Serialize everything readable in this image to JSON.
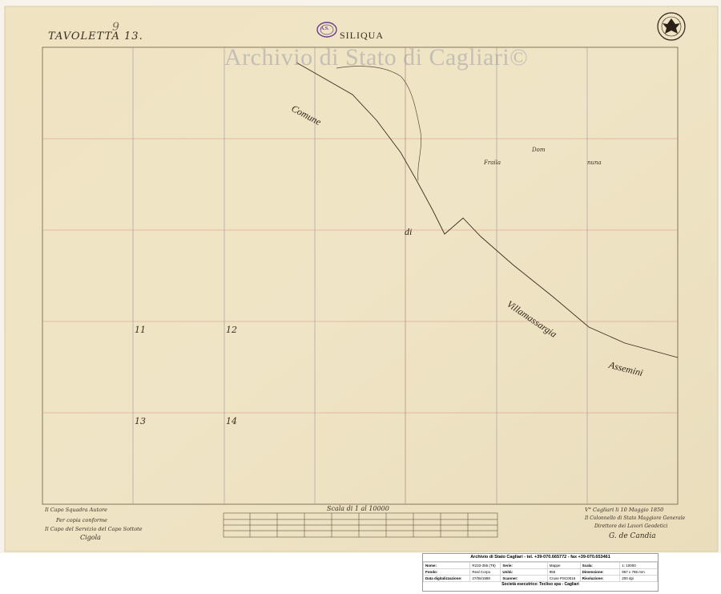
{
  "map": {
    "sheet_label": "TAVOLETTA 13.",
    "corner_number": "9",
    "title": "SILIQUA",
    "stamp_text": "A.S.",
    "watermark": "Archivio di Stato di Cagliari©",
    "grid_numbers": [
      "11",
      "12",
      "13",
      "14"
    ],
    "place_names": {
      "comune": "Comune",
      "di": "di",
      "villamassargia": "Villamassargia",
      "assemini": "Assemini",
      "fraila": "Fraila",
      "dom": "Dom",
      "nuna": "nuna"
    },
    "scale_label": "Scala di 1 al 10000",
    "left_signature": [
      "Il Capo Squadra Autore",
      "Per copia conforme",
      "Il Capo del Servizio del Capo Sottote",
      "Cigola"
    ],
    "right_signature": [
      "V° Cagliari li 10 Maggio 1850",
      "Il Colonnello di Stato Maggiore Generale",
      "Direttore dei Lavori Geodetici",
      "G. de Candia"
    ]
  },
  "info_panel": {
    "header": "Archivio di Stato Cagliari - tel. +39-070.665772 - fax +39-070.653461",
    "rows": [
      [
        [
          "Nome:",
          "R233-355 (T9)"
        ],
        [
          "Serie:",
          "Mappe"
        ],
        [
          "Scala:",
          "1: 10000"
        ]
      ],
      [
        [
          "Fondo:",
          "Real Corpo"
        ],
        [
          "Unità:",
          "955"
        ],
        [
          "Dimensione:",
          "957 x 786 mm"
        ]
      ],
      [
        [
          "Data digitalizzazione:",
          "27/06/1988"
        ],
        [
          "Scanner:",
          "Cruse PSC0016"
        ],
        [
          "Risoluzione:",
          "200 dpi"
        ]
      ]
    ],
    "footer": "Società esecutrice: Tecliso spa - Cagliari"
  }
}
